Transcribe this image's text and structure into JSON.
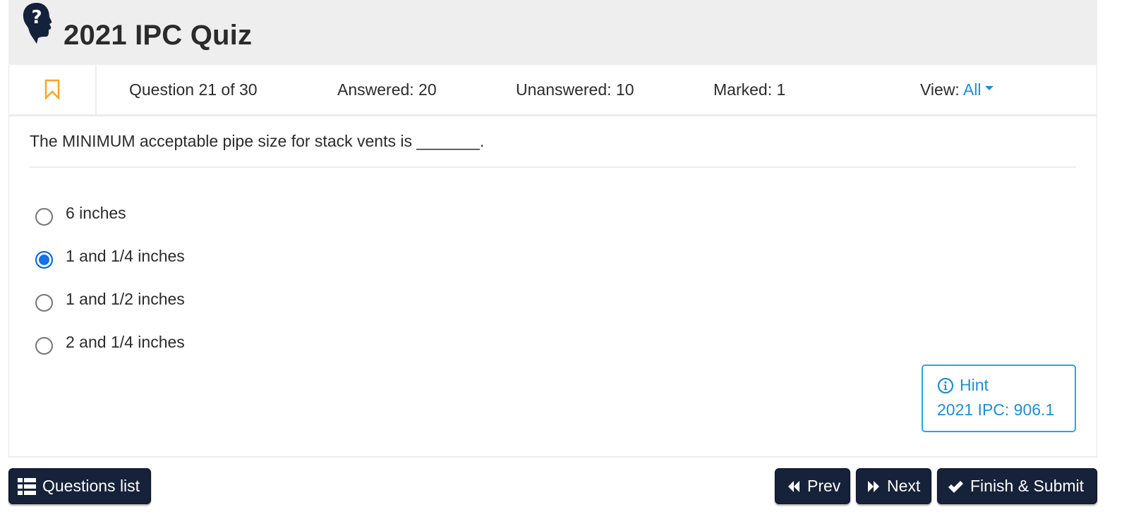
{
  "header": {
    "title": "2021 IPC Quiz",
    "logo_icon": "head-question-icon"
  },
  "status": {
    "mark_icon": "bookmark-icon",
    "question_counter": "Question 21 of 30",
    "answered": "Answered: 20",
    "unanswered": "Unanswered: 10",
    "marked": "Marked: 1",
    "view_label": "View:",
    "view_value": "All",
    "view_options_selected": "All"
  },
  "question": {
    "text": "The MINIMUM acceptable pipe size for stack vents is _______.",
    "options": [
      {
        "label": "6 inches",
        "selected": false
      },
      {
        "label": "1 and 1/4 inches",
        "selected": true
      },
      {
        "label": "1 and 1/2 inches",
        "selected": false
      },
      {
        "label": "2 and 1/4 inches",
        "selected": false
      }
    ]
  },
  "hint": {
    "icon": "info-circle-icon",
    "title": "Hint",
    "text": "2021 IPC: 906.1"
  },
  "footer": {
    "questions_list": {
      "label": "Questions list",
      "icon": "list-icon"
    },
    "prev": {
      "label": "Prev",
      "icon": "backward-icon"
    },
    "next": {
      "label": "Next",
      "icon": "forward-icon"
    },
    "finish": {
      "label": "Finish & Submit",
      "icon": "check-icon"
    }
  },
  "colors": {
    "accent": "#1a8fd6",
    "bookmark": "#f5a623",
    "button_dark": "#16213a",
    "radio_selected": "#1473e6",
    "header_bg": "#eeeeee"
  }
}
